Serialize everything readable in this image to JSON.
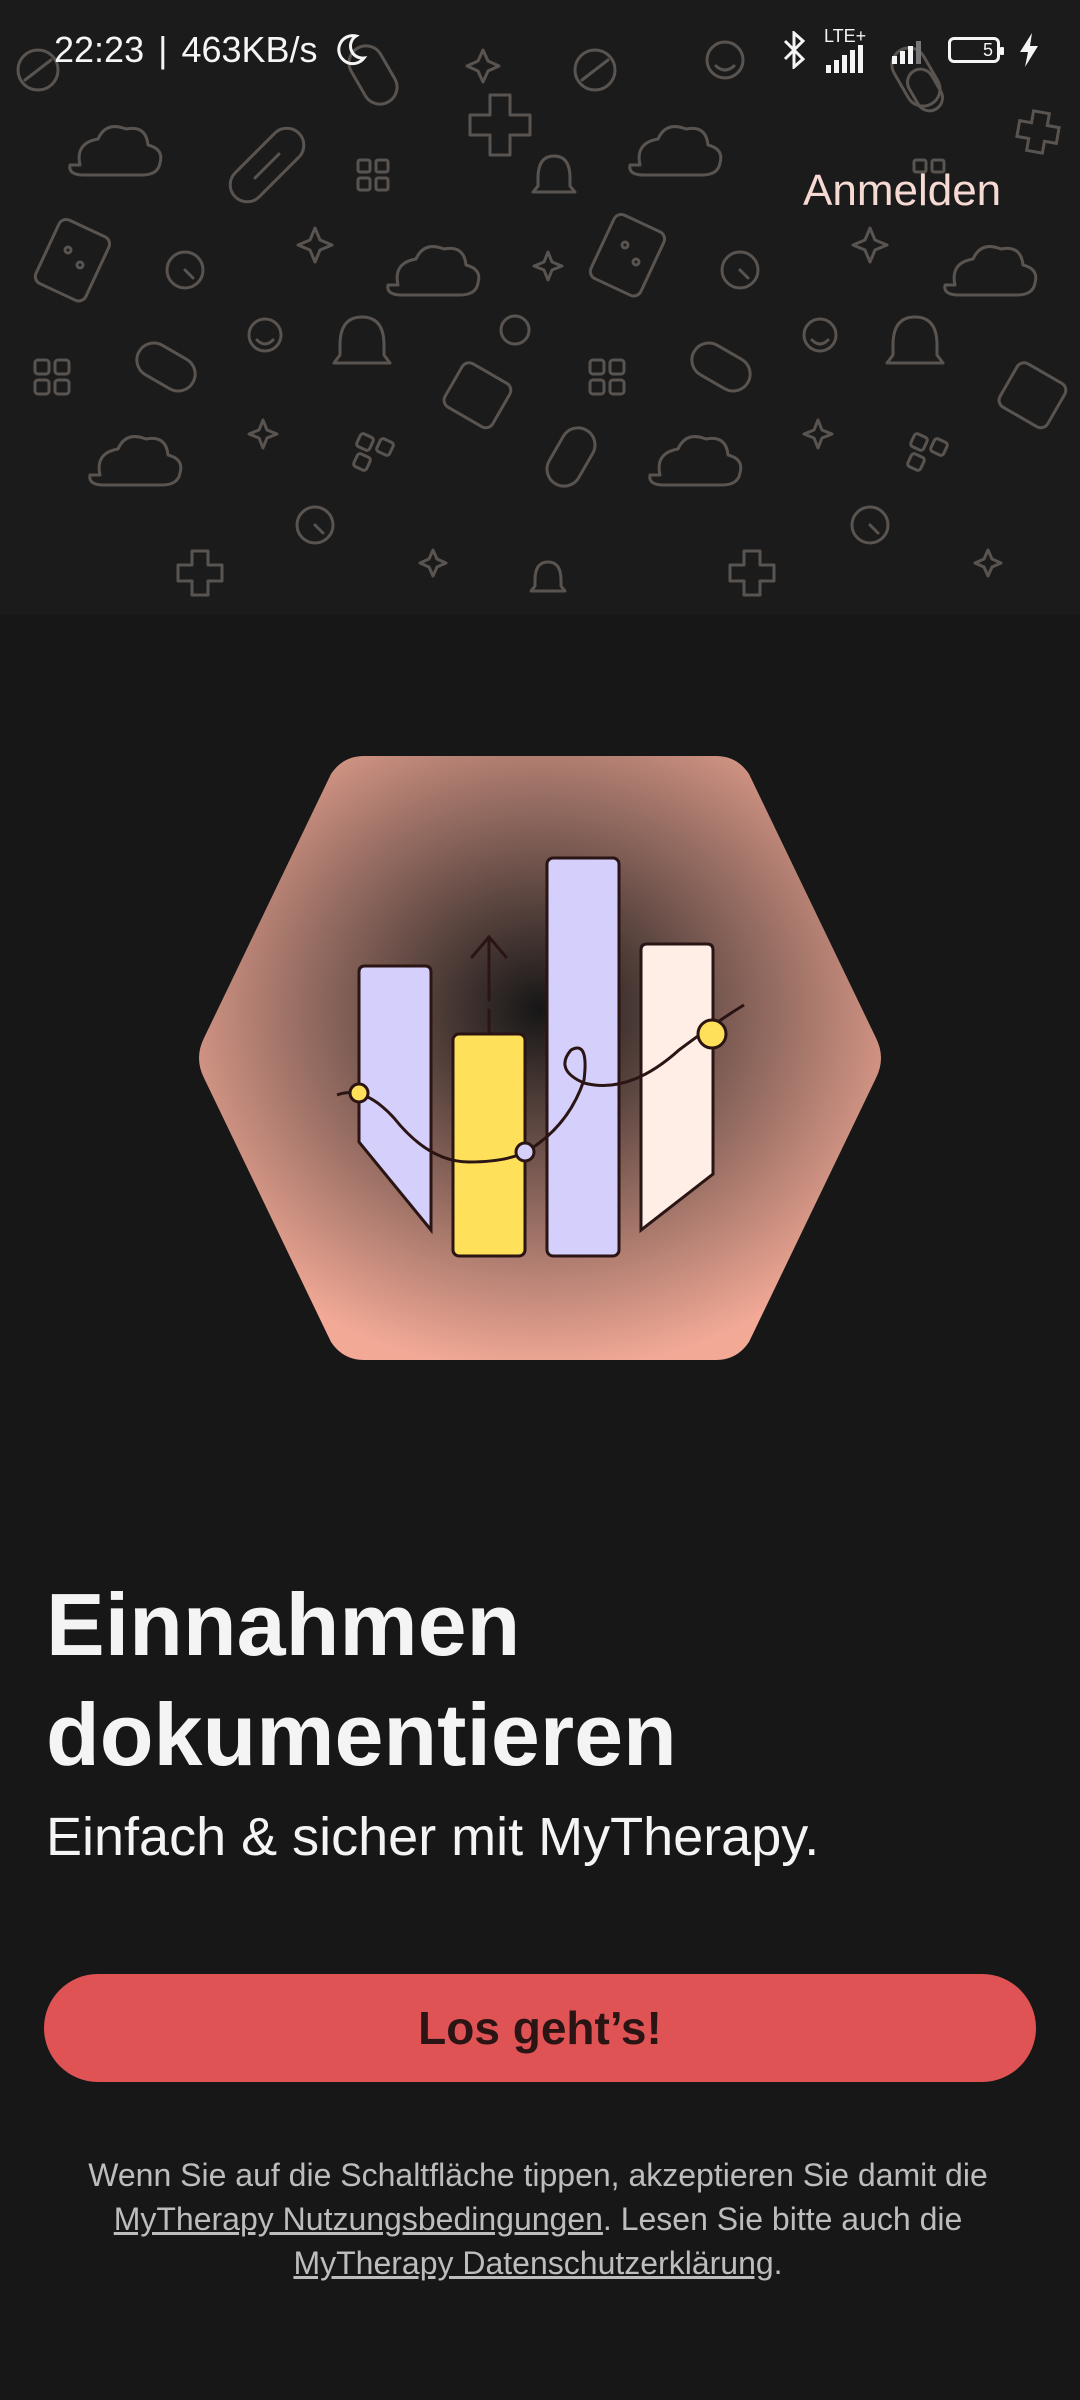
{
  "status_bar": {
    "time": "22:23",
    "speed": "463KB/s",
    "network": "LTE+",
    "battery": "5"
  },
  "header": {
    "login_label": "Anmelden"
  },
  "main": {
    "title_line1": "Einnahmen",
    "title_line2": "dokumentieren",
    "subtitle": "Einfach & sicher mit MyTherapy.",
    "cta_label": "Los geht’s!",
    "terms": {
      "prefix": "Wenn Sie auf die Schaltfläche tippen, akzeptieren Sie damit die",
      "terms_link": "MyTherapy Nutzungsbedingungen",
      "middle": ". Lesen Sie bitte auch die",
      "privacy_link": "MyTherapy Datenschutzerklärung",
      "suffix": "."
    }
  },
  "colors": {
    "background": "#171717",
    "accent": "#e05355",
    "hero_gradient": "#f2a996",
    "bar_lavender": "#d4d0fb",
    "bar_yellow": "#ffe05a",
    "bar_cream": "#ffeee6"
  },
  "icons": [
    "moon-icon",
    "bluetooth-icon",
    "signal-icon",
    "battery-icon",
    "charging-icon",
    "pill-icon",
    "medical-cross-icon"
  ]
}
